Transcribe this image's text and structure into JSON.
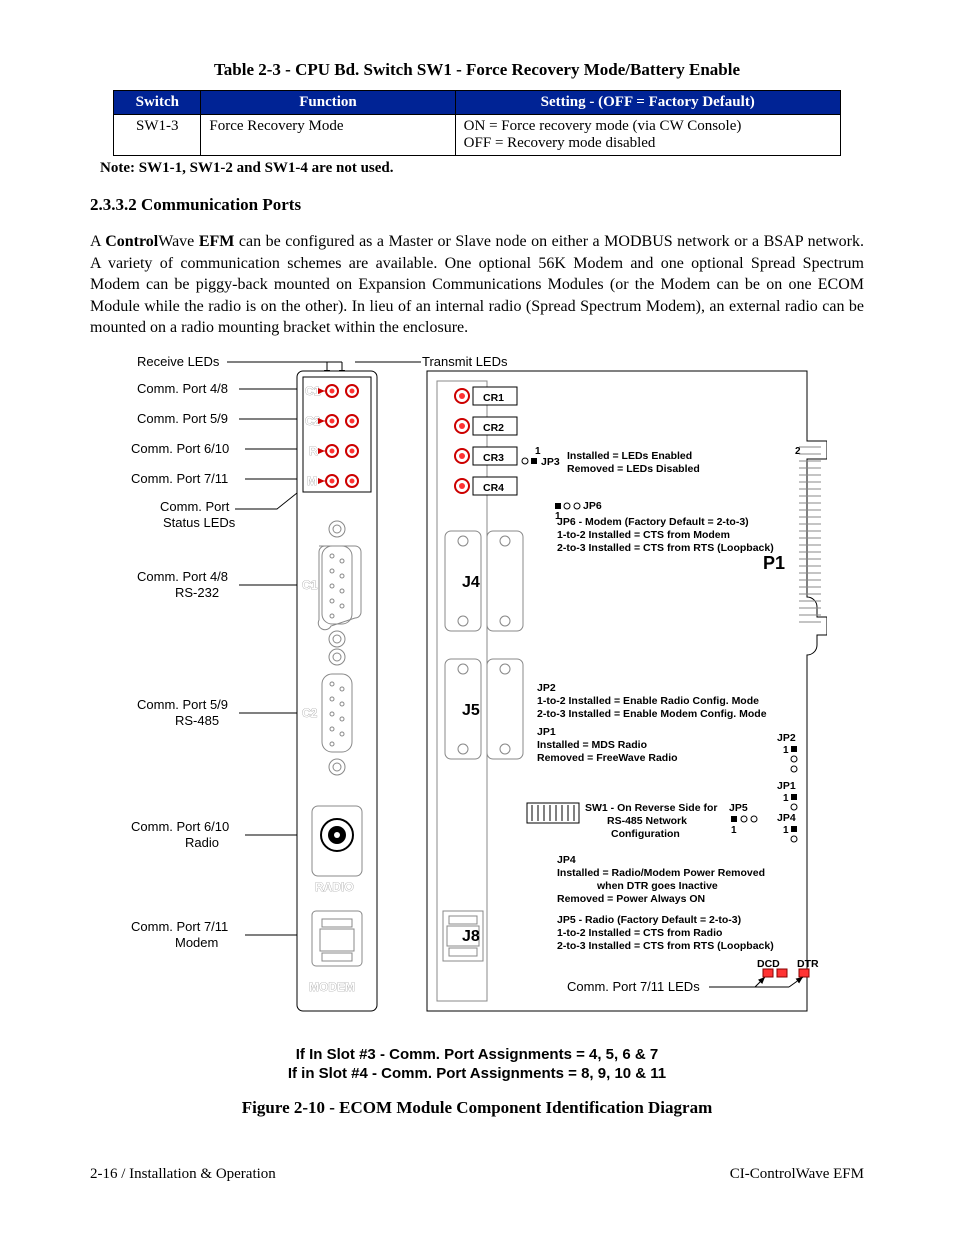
{
  "table": {
    "title": "Table 2-3 - CPU Bd. Switch SW1 - Force Recovery Mode/Battery Enable",
    "headers": {
      "c1": "Switch",
      "c2": "Function",
      "c3": "Setting - (OFF = Factory Default)"
    },
    "row": {
      "switch": "SW1-3",
      "function": "Force Recovery Mode",
      "setting_on": "ON   = Force recovery mode (via CW Console)",
      "setting_off": "OFF = Recovery mode disabled"
    },
    "note_label": "Note:",
    "note_text": "  SW1-1, SW1-2 and SW1-4 are not used."
  },
  "section": {
    "heading": "2.3.3.2  Communication Ports",
    "para_prefix": "A ",
    "para_bold1": "Control",
    "para_mid1": "Wave ",
    "para_bold2": "EFM",
    "para_rest": " can be configured as a Master or Slave node on either a MODBUS network or a BSAP network. A variety of communication schemes are available. One optional 56K Modem and one optional Spread Spectrum Modem can be piggy-back mounted on Expansion Communications Modules (or the Modem can be on one ECOM Module while the radio is on the other). In lieu of an internal radio (Spread Spectrum Modem), an external radio can be mounted on a radio mounting bracket within the enclosure."
  },
  "diagram": {
    "receive_leds": "Receive LEDs",
    "transmit_leds": "Transmit LEDs",
    "port48": "Comm. Port 4/8",
    "port59": "Comm. Port 5/9",
    "port610": "Comm. Port 6/10",
    "port711": "Comm. Port 7/11",
    "status_leds1": "Comm. Port",
    "status_leds2": "Status LEDs",
    "port48_232a": "Comm. Port 4/8",
    "port48_232b": "RS-232",
    "port59_485a": "Comm. Port 5/9",
    "port59_485b": "RS-485",
    "port610_ra": "Comm. Port 6/10",
    "port610_rb": "Radio",
    "port711_ma": "Comm. Port 7/11",
    "port711_mb": "Modem",
    "cr1": "CR1",
    "cr2": "CR2",
    "cr3": "CR3",
    "cr4": "CR4",
    "jp3_1": "1",
    "jp3": "JP3",
    "jp3_a": "Installed = LEDs Enabled",
    "jp3_b": "Removed = LEDs Disabled",
    "jp3_2": "2",
    "jp6": "JP6",
    "jp6_1": "1",
    "jp6_a": "JP6 - Modem (Factory Default = 2-to-3)",
    "jp6_b": "1-to-2 Installed = CTS from Modem",
    "jp6_c": "2-to-3 Installed = CTS from RTS (Loopback)",
    "p1": "P1",
    "j4": "J4",
    "j5": "J5",
    "j8": "J8",
    "jp2": "JP2",
    "jp2_a": "1-to-2 Installed = Enable Radio Config. Mode",
    "jp2_b": "2-to-3 Installed = Enable Modem Config. Mode",
    "jp1": "JP1",
    "jp1_a": "Installed = MDS Radio",
    "jp1_b": "Removed = FreeWave Radio",
    "jp2r": "JP2",
    "jp2r_1": "1",
    "jp1r": "JP1",
    "jp1r_1": "1",
    "jp4r": "JP4",
    "jp4r_1": "1",
    "jp5r": "JP5",
    "jp5r_1": "1",
    "sw1_a": "SW1 - On Reverse Side for",
    "sw1_b": "RS-485 Network",
    "sw1_c": "Configuration",
    "jp4": "JP4",
    "jp4_a": "Installed = Radio/Modem Power Removed",
    "jp4_b": "when DTR goes Inactive",
    "jp4_c": "Removed = Power Always ON",
    "jp5": "JP5 - Radio (Factory Default = 2-to-3)",
    "jp5_a": "1-to-2 Installed = CTS from Radio",
    "jp5_b": "2-to-3 Installed = CTS from RTS (Loopback)",
    "port_leds": "Comm. Port 7/11 LEDs",
    "dcd": "DCD",
    "dtr": "DTR",
    "radio_word": "RADIO",
    "modem_word": "MODEM",
    "c1": "C1",
    "c2": "C2",
    "r": "R",
    "m": "M",
    "slot_a": "If In Slot #3 - Comm. Port Assignments = 4, 5, 6 & 7",
    "slot_b": "If in Slot #4 - Comm. Port Assignments = 8, 9, 10 & 11",
    "fig_title": "Figure 2-10 - ECOM Module Component Identification Diagram"
  },
  "footer": {
    "left": "2-16 / Installation & Operation",
    "right": "CI-ControlWave EFM"
  }
}
